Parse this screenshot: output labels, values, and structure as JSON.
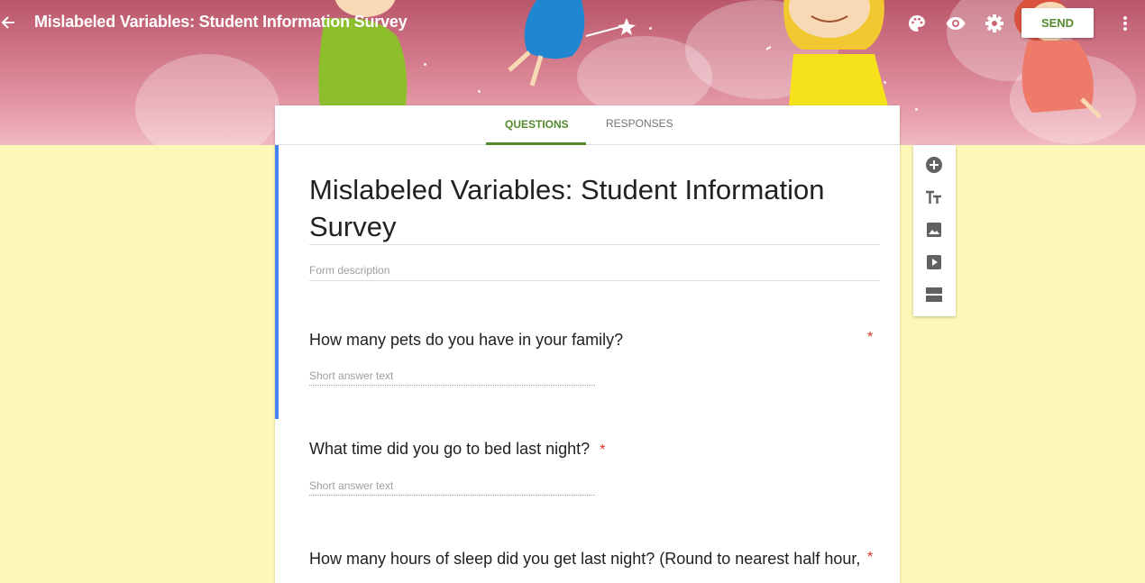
{
  "header": {
    "title": "Mislabeled Variables: Student Information Survey",
    "send_label": "SEND",
    "icons": [
      "back-arrow-icon",
      "palette-icon",
      "eye-icon",
      "gear-icon",
      "more-vert-icon"
    ]
  },
  "tabs": [
    {
      "label": "QUESTIONS",
      "active": true
    },
    {
      "label": "RESPONSES",
      "active": false
    }
  ],
  "form": {
    "title": "Mislabeled Variables: Student Information Survey",
    "description_placeholder": "Form description",
    "questions": [
      {
        "text": "How many pets do you have in your family?",
        "required_mark": "*",
        "answer_placeholder": "Short answer text"
      },
      {
        "text": "What time did you go to bed last night?",
        "required_mark": "*",
        "answer_placeholder": "Short answer text"
      },
      {
        "text": "How many hours of sleep did you get last night? (Round to nearest half hour,",
        "required_mark": "*"
      }
    ]
  },
  "toolbar": {
    "icons": [
      "add-question-icon",
      "add-title-icon",
      "add-image-icon",
      "add-video-icon",
      "add-section-icon"
    ]
  },
  "colors": {
    "accent_green": "#558b2f",
    "active_blue": "#4285f4",
    "page_background": "#fdf7b8",
    "required_red": "#d93025"
  }
}
